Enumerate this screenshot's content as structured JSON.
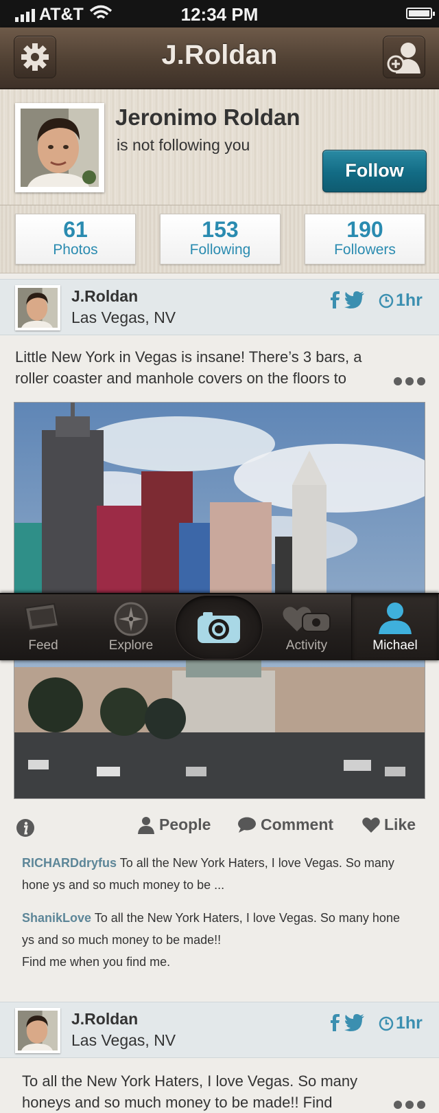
{
  "status_bar": {
    "carrier": "AT&T",
    "time": "12:34 PM"
  },
  "nav": {
    "title": "J.Roldan"
  },
  "profile": {
    "name": "Jeronimo Roldan",
    "follow_status": "is not following you",
    "follow_button": "Follow"
  },
  "stats": [
    {
      "count": "61",
      "label": "Photos"
    },
    {
      "count": "153",
      "label": "Following"
    },
    {
      "count": "190",
      "label": "Followers"
    }
  ],
  "posts": [
    {
      "user": "J.Roldan",
      "location": "Las Vegas, NV",
      "time": "1hr",
      "text": "Little New York in Vegas is insane! There’s 3 bars, a roller coaster and manhole covers on the floors to"
    },
    {
      "user": "J.Roldan",
      "location": "Las Vegas, NV",
      "time": "1hr",
      "text": "To all the New York Haters, I love Vegas. So many honeys and so much money to be made!! Find"
    }
  ],
  "actions": {
    "people": "People",
    "comment": "Comment",
    "like": "Like"
  },
  "comments": [
    {
      "user": "RICHARDdryfus",
      "text": " To all the New York Haters, I love Vegas. So many hone ys and so much money to be ..."
    },
    {
      "user": "ShanikLove",
      "text": " To all the New York Haters, I love Vegas. So many hone ys and so much money to be made!!",
      "text2": "Find me when you find me."
    }
  ],
  "tabs": [
    {
      "label": "Feed"
    },
    {
      "label": "Explore"
    },
    {
      "label": "Activity"
    },
    {
      "label": "Michael"
    }
  ],
  "colors": {
    "accent": "#2a8bb0",
    "follow_button": "#126b84",
    "nav_brown": "#4e3f32",
    "tab_active_icon": "#3fb0dc"
  },
  "icons": [
    "gear-icon",
    "add-user-icon",
    "facebook-icon",
    "twitter-icon",
    "clock-icon",
    "info-icon",
    "person-icon",
    "speech-bubble-icon",
    "heart-icon",
    "feed-icon",
    "compass-icon",
    "camera-icon",
    "activity-icon",
    "profile-icon"
  ]
}
